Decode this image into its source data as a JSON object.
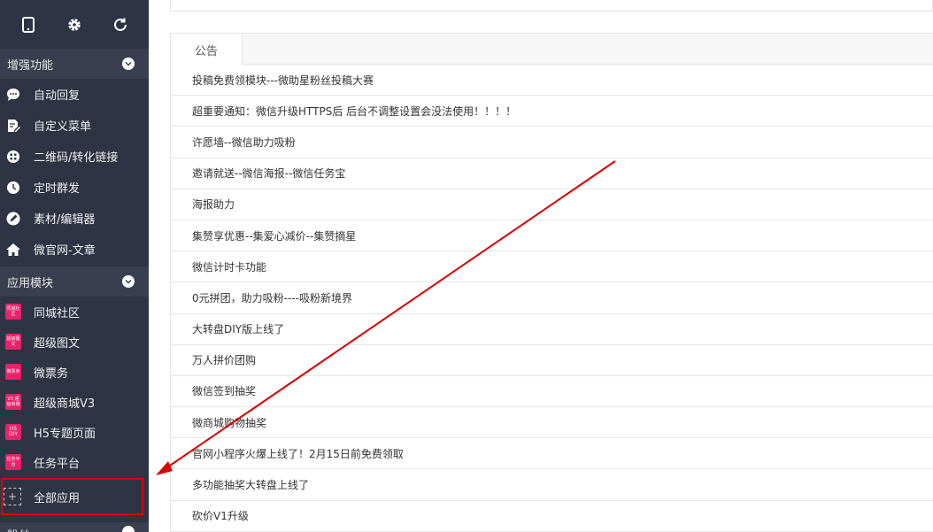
{
  "sections": {
    "enhanced": "增强功能",
    "apps": "应用模块",
    "fans": "粉丝"
  },
  "enhanced_items": [
    {
      "label": "自动回复",
      "icon": "chat-bubble-icon"
    },
    {
      "label": "自定义菜单",
      "icon": "document-edit-icon"
    },
    {
      "label": "二维码/转化链接",
      "icon": "qrcode-icon"
    },
    {
      "label": "定时群发",
      "icon": "clock-icon"
    },
    {
      "label": "素材/编辑器",
      "icon": "pencil-icon"
    },
    {
      "label": "微官网-文章",
      "icon": "home-icon"
    }
  ],
  "app_items": [
    {
      "label": "同城社区",
      "badge": "同城社区"
    },
    {
      "label": "超级图文",
      "badge": "超级图文"
    },
    {
      "label": "微票务",
      "badge": "微票务"
    },
    {
      "label": "超级商城V3",
      "badge": "V3 超级商城"
    },
    {
      "label": "H5专题页面",
      "badge": "H5 DIY"
    },
    {
      "label": "任务平台",
      "badge": "任务平台"
    }
  ],
  "all_apps": {
    "label": "全部应用",
    "icon_glyph": "+"
  },
  "notice": {
    "tab_label": "公告",
    "items": [
      "投稿免费领模块---微助星粉丝投稿大赛",
      "超重要通知：微信升级HTTPS后 后台不调整设置会没法使用！！！！",
      "许愿墙--微信助力吸粉",
      "邀请就送--微信海报--微信任务宝",
      "海报助力",
      "集赞享优惠--集爱心减价--集赞摘星",
      "微信计时卡功能",
      "0元拼团，助力吸粉----吸粉新境界",
      "大转盘DIY版上线了",
      "万人拼价团购",
      "微信签到抽奖",
      "微商城购物抽奖",
      "官网小程序火爆上线了！2月15日前免费领取",
      "多功能抽奖大转盘上线了",
      "砍价V1升级"
    ]
  },
  "colors": {
    "sidebar_bg": "#2f3444",
    "section_bg": "#3a3f4f",
    "app_badge": "#e8226b",
    "annotation_red": "#d90000"
  }
}
